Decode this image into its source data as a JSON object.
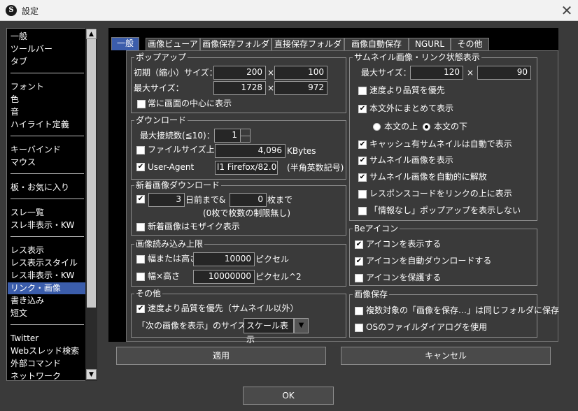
{
  "window": {
    "title": "設定",
    "app_icon_letter": "S",
    "close_symbol": "✕"
  },
  "nav": {
    "items": [
      "一般",
      "ツールバー",
      "タブ",
      "フォント",
      "色",
      "音",
      "ハイライト定義",
      "キーバインド",
      "マウス",
      "板・お気に入り",
      "スレ一覧",
      "スレ非表示・KW",
      "レス表示",
      "レス表示スタイル",
      "レス非表示・KW",
      "リンク・画像",
      "書き込み",
      "短文",
      "Twitter",
      "Webスレッド検索",
      "外部コマンド",
      "ネットワーク"
    ],
    "selected": "リンク・画像",
    "scroll_up": "▲",
    "scroll_down": "▼"
  },
  "tabs": [
    "一般",
    "画像ビューア",
    "画像保存フォルダ",
    "直接保存フォルダ",
    "画像自動保存",
    "NGURL",
    "その他"
  ],
  "active_tab": "一般",
  "popup": {
    "title": "ポップアップ",
    "initial_size_label": "初期（縮小）サイズ：",
    "initial_w": "200",
    "initial_h": "100",
    "max_size_label": "最大サイズ：",
    "max_w": "1728",
    "max_h": "972",
    "times": "×",
    "center_label": "常に画面の中心に表示",
    "center_checked": false
  },
  "download": {
    "title": "ダウンロード",
    "max_conn_label": "最大接続数(≦10)：",
    "max_conn": "1",
    "filesize_label": "ファイルサイズ上限",
    "filesize_checked": false,
    "filesize": "4,096",
    "filesize_unit": "KBytes",
    "ua_label": "User-Agent",
    "ua_checked": true,
    "ua_value": "l1 Firefox/82.0",
    "ua_note": "(半角英数記号)"
  },
  "new_images": {
    "title": "新着画像ダウンロード",
    "days_checked": true,
    "days": "3",
    "days_suffix": "日前まで",
    "amp": "&",
    "count": "0",
    "count_suffix": "枚まで",
    "note": "(0枚で枚数の制限無し)",
    "mosaic_label": "新着画像はモザイク表示",
    "mosaic_checked": false
  },
  "load_limit": {
    "title": "画像読み込み上限",
    "wh_label": "幅または高さ",
    "wh_checked": false,
    "wh_value": "10000",
    "wh_unit": "ピクセル",
    "area_label": "幅×高さ",
    "area_checked": false,
    "area_value": "10000000",
    "area_unit": "ピクセル^2"
  },
  "other": {
    "title": "その他",
    "speed_label": "速度より品質を優先（サムネイル以外）",
    "speed_checked": true,
    "next_size_label": "「次の画像を表示」のサイズ：",
    "next_size_value": "スケール表示",
    "dropdown_arrow": "▼"
  },
  "thumbnail": {
    "title": "サムネイル画像・リンク状態表示",
    "max_size_label": "最大サイズ：",
    "max_w": "120",
    "max_h": "90",
    "times": "×",
    "quality_label": "速度より品質を優先",
    "quality_checked": false,
    "outside_label": "本文外にまとめて表示",
    "outside_checked": true,
    "radio_top_label": "本文の上",
    "radio_bottom_label": "本文の下",
    "radio_selected": "本文の下",
    "cache_label": "キャッシュ有サムネイルは自動で表示",
    "cache_checked": true,
    "show_thumb_label": "サムネイル画像を表示",
    "show_thumb_checked": true,
    "auto_open_label": "サムネイル画像を自動的に解放",
    "auto_open_checked": true,
    "resp_code_label": "レスポンスコードをリンクの上に表示",
    "resp_code_checked": false,
    "no_info_label": "「情報なし」ポップアップを表示しない",
    "no_info_checked": false
  },
  "be_icon": {
    "title": "Beアイコン",
    "show_label": "アイコンを表示する",
    "show_checked": true,
    "auto_dl_label": "アイコンを自動ダウンロードする",
    "auto_dl_checked": true,
    "protect_label": "アイコンを保護する",
    "protect_checked": false
  },
  "image_save": {
    "title": "画像保存",
    "same_folder_label": "複数対象の「画像を保存…」は同じフォルダに保存",
    "same_folder_checked": false,
    "os_dialog_label": "OSのファイルダイアログを使用",
    "os_dialog_checked": false
  },
  "buttons": {
    "apply": "適用",
    "cancel": "キャンセル",
    "ok": "OK"
  },
  "check_mark": "✔"
}
